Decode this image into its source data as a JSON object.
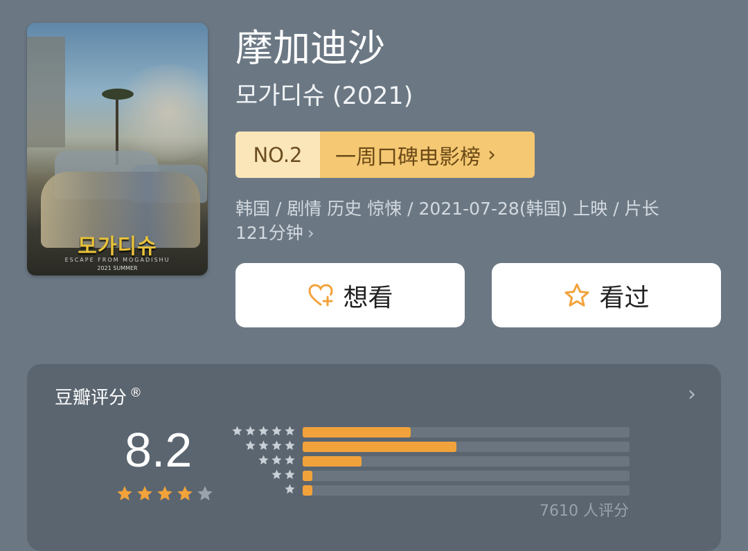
{
  "movie": {
    "title": "摩加迪沙",
    "original_title": "모가디슈 (2021)",
    "poster_title": "모가디슈",
    "poster_subtitle": "ESCAPE FROM MOGADISHU",
    "poster_date": "2021 SUMMER",
    "rank": {
      "number": "NO.2",
      "list_name": "一周口碑电影榜",
      "chevron": "›"
    },
    "meta_line1": "韩国 / 剧情 历史 惊悚 / 2021-07-28(韩国) 上映 / 片长",
    "meta_line2": "121分钟",
    "meta_chevron": "›"
  },
  "actions": {
    "want_label": "想看",
    "want_icon": "heart-plus-icon",
    "seen_label": "看过",
    "seen_icon": "star-outline-icon"
  },
  "rating": {
    "title": "豆瓣评分",
    "registered_mark": "®",
    "more_chevron": "›",
    "score": "8.2",
    "stars_filled": 4,
    "stars_total": 5,
    "count_text": "7610 人评分",
    "distribution": [
      {
        "stars": 5,
        "fraction": 0.33
      },
      {
        "stars": 4,
        "fraction": 0.47
      },
      {
        "stars": 3,
        "fraction": 0.18
      },
      {
        "stars": 2,
        "fraction": 0.03
      },
      {
        "stars": 1,
        "fraction": 0.03
      }
    ]
  },
  "colors": {
    "background": "#6b7884",
    "accent_orange": "#f2a23a",
    "badge_light": "#fbe6ba",
    "badge_dark": "#f5c873"
  }
}
